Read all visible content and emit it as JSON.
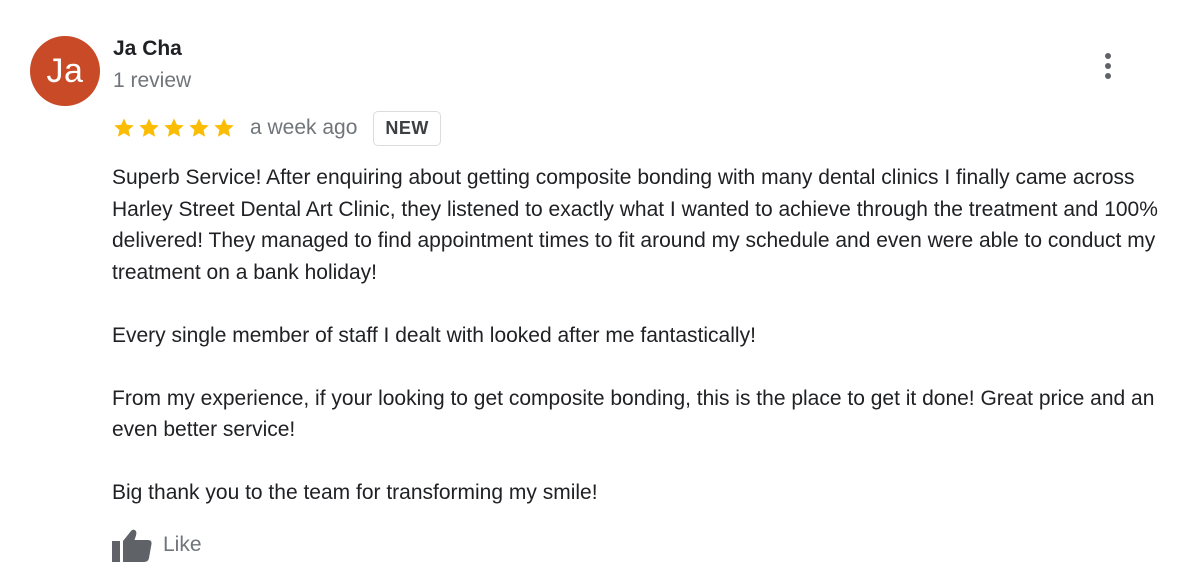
{
  "reviewer": {
    "initials": "Ja",
    "name": "Ja Cha",
    "review_count": "1 review",
    "avatar_color": "#c94a26"
  },
  "more_menu_icon": "more-vert-icon",
  "rating": {
    "stars": 5,
    "max": 5,
    "star_color": "#fbbc04"
  },
  "time_ago": "a week ago",
  "badge": "NEW",
  "paragraphs": [
    "Superb Service! After enquiring about getting composite bonding with many dental clinics I finally came across Harley Street Dental Art Clinic, they listened to exactly what I wanted to achieve through the treatment and 100% delivered! They managed to find appointment times to fit around my schedule and even were able to conduct my treatment on a bank holiday!",
    "Every single member of staff I dealt with looked after me fantastically!",
    "From my experience, if your looking to get composite bonding, this is the place to get it done! Great price and an even better service!",
    "Big thank you to the team for transforming my smile!"
  ],
  "like": {
    "label": "Like",
    "icon": "thumb-up-icon"
  }
}
